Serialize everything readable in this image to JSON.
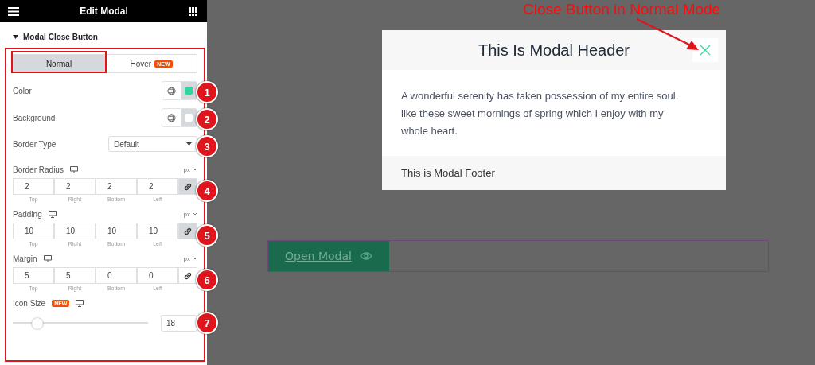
{
  "panel": {
    "title": "Edit Modal",
    "section": "Modal Close Button",
    "tabs": [
      {
        "label": "Normal",
        "selected": true
      },
      {
        "label": "Hover",
        "selected": false,
        "badge": "NEW"
      }
    ],
    "controls": [
      {
        "kind": "color",
        "label": "Color",
        "color": "#34d3a0",
        "marker": "1"
      },
      {
        "kind": "color",
        "label": "Background",
        "color": "#ffffff",
        "marker": "2"
      },
      {
        "kind": "select",
        "label": "Border Type",
        "value": "Default",
        "marker": "3"
      },
      {
        "kind": "dimensions",
        "label": "Border Radius",
        "unit": "px",
        "linked": true,
        "marker": "4",
        "fields": [
          {
            "value": "2",
            "label": "Top"
          },
          {
            "value": "2",
            "label": "Right"
          },
          {
            "value": "2",
            "label": "Bottom"
          },
          {
            "value": "2",
            "label": "Left"
          }
        ]
      },
      {
        "kind": "dimensions",
        "label": "Padding",
        "unit": "px",
        "linked": true,
        "marker": "5",
        "fields": [
          {
            "value": "10",
            "label": "Top"
          },
          {
            "value": "10",
            "label": "Right"
          },
          {
            "value": "10",
            "label": "Bottom"
          },
          {
            "value": "10",
            "label": "Left"
          }
        ]
      },
      {
        "kind": "dimensions",
        "label": "Margin",
        "unit": "px",
        "linked": false,
        "marker": "6",
        "fields": [
          {
            "value": "5",
            "label": "Top"
          },
          {
            "value": "5",
            "label": "Right"
          },
          {
            "value": "0",
            "label": "Bottom"
          },
          {
            "value": "0",
            "label": "Left"
          }
        ]
      },
      {
        "kind": "slider",
        "label": "Icon Size",
        "badge": "NEW",
        "level": 0.18,
        "value": "18",
        "marker": "7"
      }
    ]
  },
  "annotation": "Close Button in Normal Mode",
  "modal": {
    "header": "This Is Modal Header",
    "body": "A wonderful serenity has taken possession of my entire soul, like these sweet mornings of spring which I enjoy with my whole heart.",
    "footer": "This is Modal Footer"
  },
  "open_button": {
    "label": "Open Modal"
  }
}
